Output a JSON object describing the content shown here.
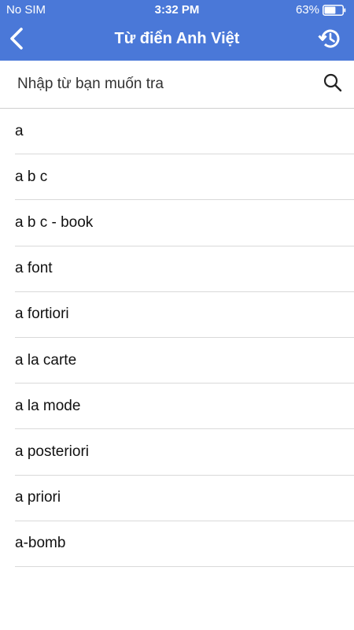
{
  "status_bar": {
    "carrier": "No SIM",
    "time": "3:32 PM",
    "battery_percent": "63%",
    "battery_level": 0.63
  },
  "nav": {
    "title": "Từ điển Anh Việt",
    "back_icon": "chevron-left-icon",
    "history_icon": "history-icon"
  },
  "search": {
    "placeholder": "Nhập từ bạn muốn tra",
    "value": "",
    "icon": "search-icon"
  },
  "words": [
    "a",
    "a b c",
    "a b c - book",
    "a font",
    "a fortiori",
    "a la carte",
    "a la mode",
    "a posteriori",
    "a priori",
    "a-bomb"
  ],
  "colors": {
    "header": "#4a78d8",
    "divider": "#d9d9d9",
    "text": "#111111"
  }
}
